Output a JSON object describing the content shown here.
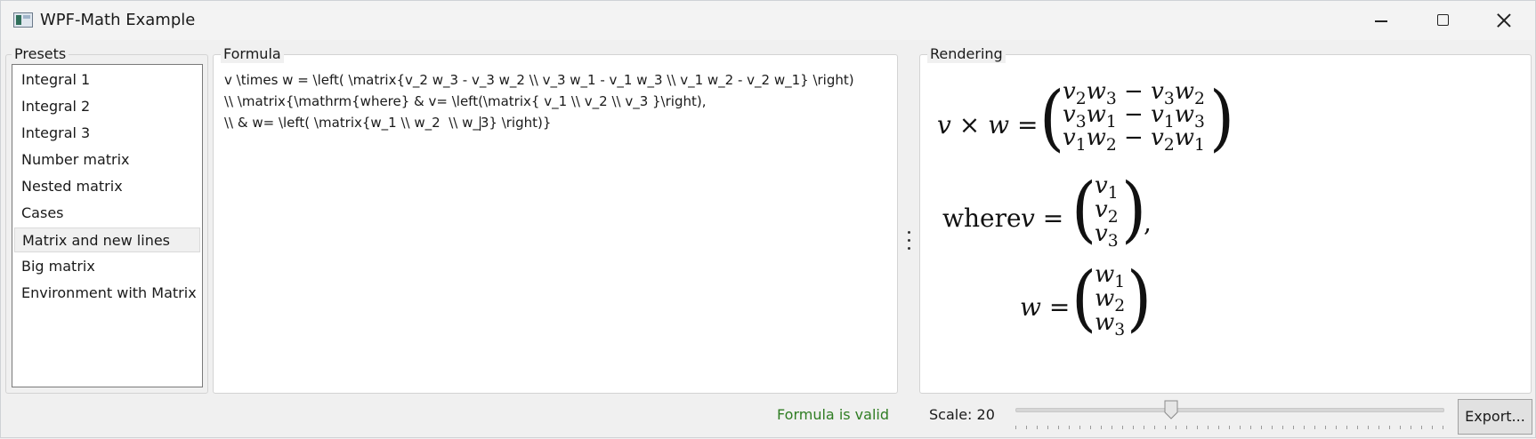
{
  "window": {
    "title": "WPF-Math Example",
    "minimize": "minimize",
    "maximize": "maximize",
    "close": "close"
  },
  "presets": {
    "label": "Presets",
    "items": [
      {
        "label": "Integral 1",
        "selected": false
      },
      {
        "label": "Integral 2",
        "selected": false
      },
      {
        "label": "Integral 3",
        "selected": false
      },
      {
        "label": "Number matrix",
        "selected": false
      },
      {
        "label": "Nested matrix",
        "selected": false
      },
      {
        "label": "Cases",
        "selected": false
      },
      {
        "label": "Matrix and new lines",
        "selected": true
      },
      {
        "label": "Big matrix",
        "selected": false
      },
      {
        "label": "Environment with Matrix",
        "selected": false
      }
    ]
  },
  "formula": {
    "label": "Formula",
    "line1": "v \\times w = \\left( \\matrix{v_2 w_3 - v_3 w_2 \\\\ v_3 w_1 - v_1 w_3 \\\\ v_1 w_2 - v_2 w_1} \\right)",
    "line2": "\\\\ \\matrix{\\mathrm{where} & v= \\left(\\matrix{ v_1 \\\\ v_2 \\\\ v_3 }\\right),",
    "line3_before_caret": "\\\\ & w= \\left( \\matrix{w_1 \\\\ w_2  \\\\ w_",
    "line3_after_caret": "3} \\right)}",
    "status": "Formula is valid",
    "status_color": "#2f7d23"
  },
  "rendering": {
    "label": "Rendering",
    "eq1_lhs": "v × w =",
    "eq1_rows": [
      {
        "a": "v",
        "a_sub": "2",
        "b": "w",
        "b_sub": "3",
        "op": " − ",
        "c": "v",
        "c_sub": "3",
        "d": "w",
        "d_sub": "2"
      },
      {
        "a": "v",
        "a_sub": "3",
        "b": "w",
        "b_sub": "1",
        "op": " − ",
        "c": "v",
        "c_sub": "1",
        "d": "w",
        "d_sub": "3"
      },
      {
        "a": "v",
        "a_sub": "1",
        "b": "w",
        "b_sub": "2",
        "op": " − ",
        "c": "v",
        "c_sub": "2",
        "d": "w",
        "d_sub": "1"
      }
    ],
    "where_word": "where",
    "eq2_lhs": "v =",
    "eq2_rows": [
      {
        "v": "v",
        "s": "1"
      },
      {
        "v": "v",
        "s": "2"
      },
      {
        "v": "v",
        "s": "3"
      }
    ],
    "eq2_comma": ",",
    "eq3_lhs": "w =",
    "eq3_rows": [
      {
        "v": "w",
        "s": "1"
      },
      {
        "v": "w",
        "s": "2"
      },
      {
        "v": "w",
        "s": "3"
      }
    ]
  },
  "scale": {
    "label": "Scale: 20",
    "value": 20
  },
  "export_label": "Export..."
}
